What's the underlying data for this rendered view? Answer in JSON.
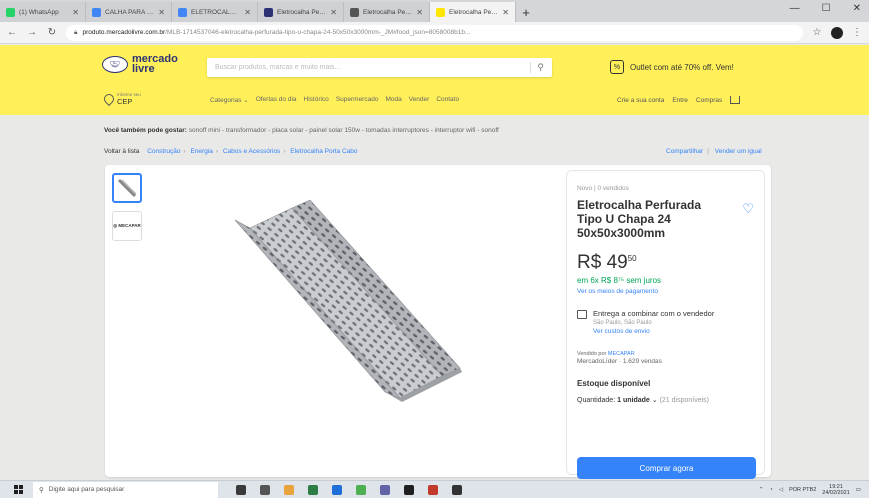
{
  "browser": {
    "tabs": [
      {
        "label": "(1) WhatsApp",
        "color": "#25d366",
        "active": false
      },
      {
        "label": "CALHA PARA FIAÇÃO - Goo",
        "color": "#4285f4",
        "active": false
      },
      {
        "label": "ELETROCALHA perfurada -",
        "color": "#4285f4",
        "active": false
      },
      {
        "label": "Eletrocalha Perfurada Tipo",
        "color": "#2d3277",
        "active": false
      },
      {
        "label": "Eletrocalha Perfurada Galv.",
        "color": "#555555",
        "active": false
      },
      {
        "label": "Eletrocalha Perfurada Tipo",
        "color": "#ffe600",
        "active": true
      }
    ],
    "new_tab": "+",
    "url_host": "produto.mercadolivre.com.br",
    "url_path": "/MLB-1714537046-eletrocalha-perfurada-tipo-u-chapa-24-50x50x3000mm-_JM#food_json=8058008b1b..."
  },
  "header": {
    "logo_line1": "mercado",
    "logo_line2": "livre",
    "search_placeholder": "Buscar produtos, marcas e muito mais...",
    "promo": "Outlet com até 70% off. Vem!",
    "cep_small": "Informe seu",
    "cep": "CEP",
    "categories": [
      "Categorias ⌄",
      "Ofertas do dia",
      "Histórico",
      "Supermercado",
      "Moda",
      "Vender",
      "Contato"
    ],
    "user_nav": [
      "Crie a sua conta",
      "Entre",
      "Compras"
    ]
  },
  "related": {
    "label": "Você também pode gostar:",
    "items": "sonoff mini - transformador - placa solar - painel solar 150w - tomadas interruptores - interruptor wifi - sonoff"
  },
  "breadcrumb": {
    "back": "Voltar à lista",
    "items": [
      "Construção",
      "Energia",
      "Cabos e Acessórios",
      "Eletrocalha Porta Cabo"
    ],
    "share": "Compartilhar",
    "sell": "Vender um igual"
  },
  "product": {
    "condition": "Novo  |  0 vendidos",
    "title": "Eletrocalha Perfurada Tipo U Chapa 24 50x50x3000mm",
    "currency": "R$",
    "price_int": "49",
    "price_cents": "50",
    "installments": "em 6x R$ 8⁷⁵ sem juros",
    "payment_link": "Ver os meios de pagamento",
    "ship_main": "Entrega a combinar com o vendedor",
    "ship_loc": "São Paulo, São Paulo",
    "ship_cost": "Ver custos de envio",
    "seller_label": "Vendido por",
    "seller_name": "MECAPAR",
    "seller_sales": "MercadoLíder  ·  1.629 vendas",
    "stock": "Estoque disponível",
    "qty_label": "Quantidade:",
    "qty_value": "1 unidade",
    "qty_avail": "(21 disponíveis)",
    "buy": "Comprar agora",
    "thumb2_brand": "◎ MECAPAR"
  },
  "taskbar": {
    "search": "Digite aqui para pesquisar",
    "app_colors": [
      "#3a3a3a",
      "#555555",
      "#e8a33d",
      "#2d7d46",
      "#1e6fd9",
      "#4caf50",
      "#6264a7",
      "#1f1f1f",
      "#c0392b",
      "#333333"
    ],
    "lang": "POR PTB2",
    "time": "19:21",
    "date": "24/02/2021"
  }
}
